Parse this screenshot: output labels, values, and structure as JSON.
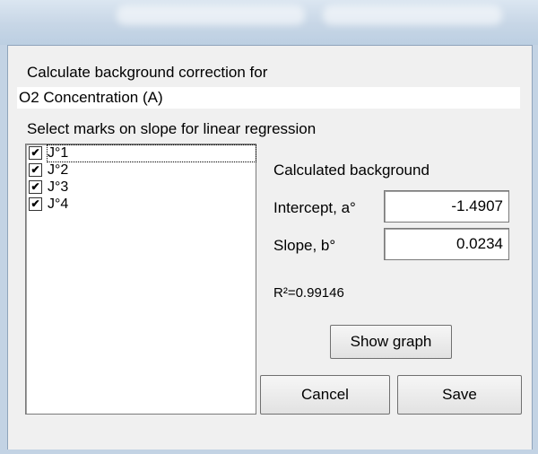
{
  "header": {
    "label": "Calculate background correction for"
  },
  "target": {
    "value": "O2 Concentration  (A)"
  },
  "marks": {
    "label": "Select marks on slope for linear regression",
    "items": [
      {
        "label": "J°1",
        "checked": true
      },
      {
        "label": "J°2",
        "checked": true
      },
      {
        "label": "J°3",
        "checked": true
      },
      {
        "label": "J°4",
        "checked": true
      }
    ]
  },
  "background": {
    "heading": "Calculated background",
    "intercept_label": "Intercept, a°",
    "intercept_value": "-1.4907",
    "slope_label": "Slope, b°",
    "slope_value": "0.0234",
    "r2": "R²=0.99146"
  },
  "buttons": {
    "show_graph": "Show graph",
    "cancel": "Cancel",
    "save": "Save"
  }
}
